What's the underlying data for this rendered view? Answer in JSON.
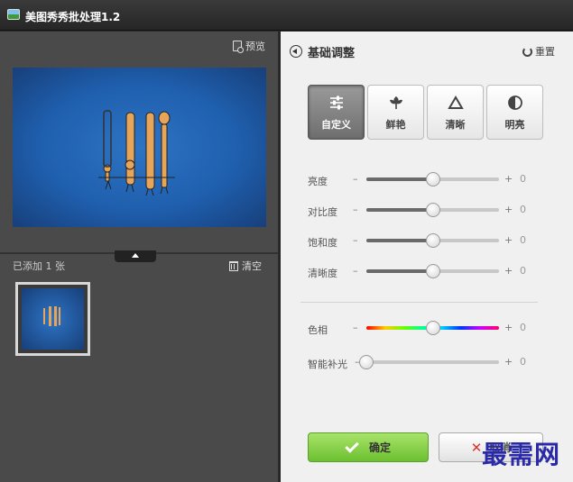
{
  "window": {
    "title": "美图秀秀批处理1.2"
  },
  "left_panel": {
    "preview_label": "预览",
    "added_label": "已添加 1 张",
    "clear_label": "清空"
  },
  "right_panel": {
    "title": "基础调整",
    "reset_label": "重置",
    "presets": [
      {
        "label": "自定义",
        "icon": "sliders-icon",
        "active": true
      },
      {
        "label": "鲜艳",
        "icon": "flower-icon",
        "active": false
      },
      {
        "label": "清晰",
        "icon": "triangle-icon",
        "active": false
      },
      {
        "label": "明亮",
        "icon": "contrast-circle-icon",
        "active": false
      }
    ],
    "sliders": [
      {
        "label": "亮度",
        "minus": "–",
        "plus": "+",
        "value": "0",
        "position": 0.5
      },
      {
        "label": "对比度",
        "minus": "–",
        "plus": "+",
        "value": "0",
        "position": 0.5
      },
      {
        "label": "饱和度",
        "minus": "–",
        "plus": "+",
        "value": "0",
        "position": 0.5
      },
      {
        "label": "清晰度",
        "minus": "–",
        "plus": "+",
        "value": "0",
        "position": 0.5
      }
    ],
    "color_sliders": [
      {
        "label": "色相",
        "minus": "–",
        "plus": "+",
        "value": "0",
        "position": 0.5
      },
      {
        "label": "智能补光",
        "minus": "–",
        "plus": "+",
        "value": "0",
        "position": 0.0
      }
    ],
    "ok_label": "确定",
    "cancel_label": "取消"
  },
  "watermark": "最需网",
  "colors": {
    "accent_green": "#6cc030",
    "panel_bg": "#f0f0f0",
    "dark_bg": "#4a4a4a"
  }
}
